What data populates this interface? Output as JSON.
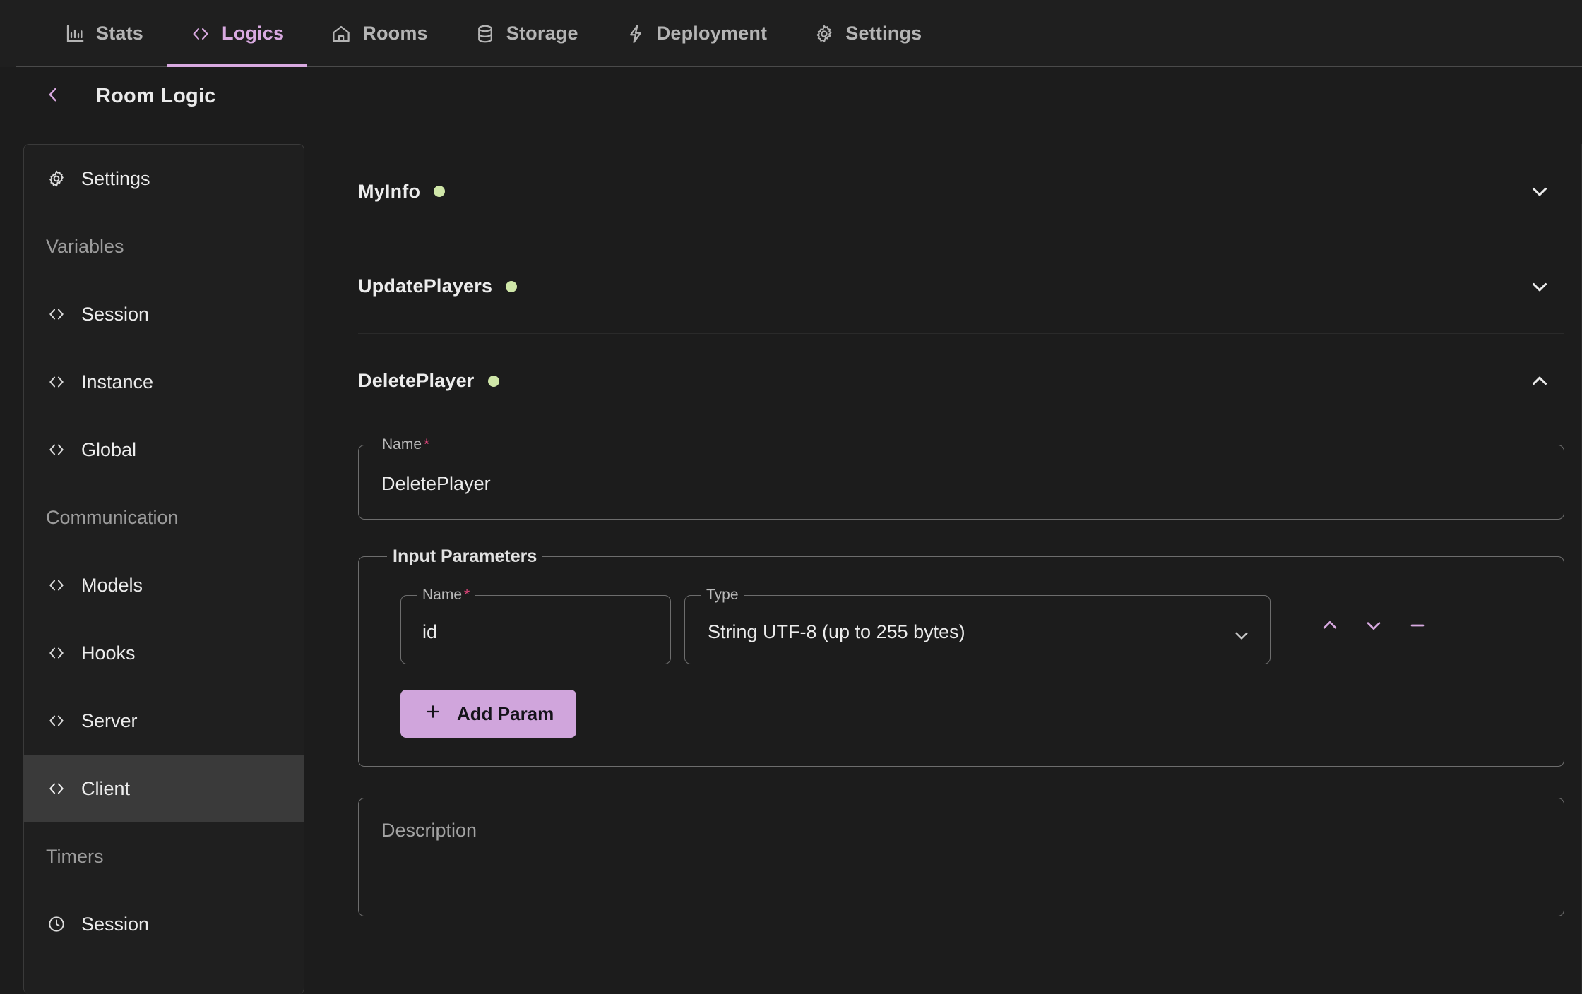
{
  "theme": {
    "bg": "#1c1c1c",
    "panel": "#1f1f1f",
    "accent": "#d8a9e0",
    "accent_button": "#d0a5dc",
    "status_green": "#cfe6a8",
    "required_red": "#e0457b",
    "text_primary": "#ececec",
    "text_muted": "#9c9c9c",
    "border": "#6d6d6d"
  },
  "topnav": {
    "tabs": [
      {
        "label": "Stats",
        "icon": "bar-chart-icon",
        "active": false
      },
      {
        "label": "Logics",
        "icon": "code-brackets-icon",
        "active": true
      },
      {
        "label": "Rooms",
        "icon": "home-icon",
        "active": false
      },
      {
        "label": "Storage",
        "icon": "database-icon",
        "active": false
      },
      {
        "label": "Deployment",
        "icon": "lightning-bolt-icon",
        "active": false
      },
      {
        "label": "Settings",
        "icon": "gear-icon",
        "active": false
      }
    ]
  },
  "header": {
    "back_icon": "chevron-left-icon",
    "title": "Room Logic"
  },
  "sidebar": {
    "items": [
      {
        "label": "Settings",
        "icon": "gear-icon",
        "type": "item",
        "selected": false
      },
      {
        "label": "Variables",
        "icon": "",
        "type": "group",
        "selected": false
      },
      {
        "label": "Session",
        "icon": "code-brackets-icon",
        "type": "item",
        "selected": false
      },
      {
        "label": "Instance",
        "icon": "code-brackets-icon",
        "type": "item",
        "selected": false
      },
      {
        "label": "Global",
        "icon": "code-brackets-icon",
        "type": "item",
        "selected": false
      },
      {
        "label": "Communication",
        "icon": "",
        "type": "group",
        "selected": false
      },
      {
        "label": "Models",
        "icon": "code-brackets-icon",
        "type": "item",
        "selected": false
      },
      {
        "label": "Hooks",
        "icon": "code-brackets-icon",
        "type": "item",
        "selected": false
      },
      {
        "label": "Server",
        "icon": "code-brackets-icon",
        "type": "item",
        "selected": false
      },
      {
        "label": "Client",
        "icon": "code-brackets-icon",
        "type": "item",
        "selected": true
      },
      {
        "label": "Timers",
        "icon": "",
        "type": "group",
        "selected": false
      },
      {
        "label": "Session",
        "icon": "clock-icon",
        "type": "item",
        "selected": false
      }
    ]
  },
  "main": {
    "accordions": [
      {
        "title": "MyInfo",
        "status": "green",
        "expanded": false,
        "chevron": "chevron-down-icon"
      },
      {
        "title": "UpdatePlayers",
        "status": "green",
        "expanded": false,
        "chevron": "chevron-down-icon"
      },
      {
        "title": "DeletePlayer",
        "status": "green",
        "expanded": true,
        "chevron": "chevron-up-icon"
      }
    ],
    "expanded_form": {
      "name_field": {
        "legend": "Name",
        "required_mark": "*",
        "value": "DeletePlayer"
      },
      "input_parameters": {
        "legend": "Input Parameters",
        "params": [
          {
            "name_legend": "Name",
            "required_mark": "*",
            "name_value": "id",
            "type_legend": "Type",
            "type_value": "String UTF-8 (up to 255 bytes)",
            "actions": [
              "move-up-icon",
              "move-down-icon",
              "remove-icon"
            ]
          }
        ],
        "add_button": {
          "label": "Add Param",
          "icon": "plus-icon"
        }
      },
      "description": {
        "placeholder": "Description",
        "value": ""
      }
    }
  }
}
